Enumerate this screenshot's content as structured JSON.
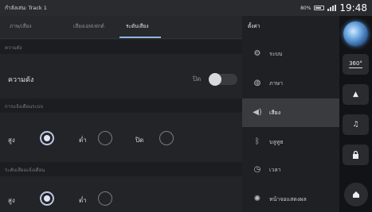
{
  "status_bar": {
    "title": "กำลังเล่น: Track 1",
    "battery_percent": "80%",
    "clock": "19:48"
  },
  "tabs": [
    {
      "label": "ภาพ/เสียง",
      "active": false
    },
    {
      "label": "เสียงเอฟเฟกต์",
      "active": false
    },
    {
      "label": "ระดับเสียง",
      "active": true
    }
  ],
  "sections": {
    "volume_header": "ความดัง",
    "volume_row_label": "ความดัง",
    "volume_toggle_label": "ปิด",
    "volume_toggle_state": "off",
    "alert_header": "การแจ้งเตือนระบบ",
    "alert_options": [
      {
        "label": "สูง",
        "checked": true
      },
      {
        "label": "ต่ำ",
        "checked": false
      },
      {
        "label": "ปิด",
        "checked": false
      }
    ],
    "reminder_header": "ระดับเสียงแจ้งเตือน",
    "reminder_options": [
      {
        "label": "สูง",
        "checked": true
      },
      {
        "label": "ต่ำ",
        "checked": false
      }
    ]
  },
  "menu": {
    "title": "ตั้งค่า",
    "items": [
      {
        "label": "ระบบ",
        "icon": "gear-icon",
        "active": false
      },
      {
        "label": "ภาษา",
        "icon": "globe-icon",
        "active": false
      },
      {
        "label": "เสียง",
        "icon": "speaker-icon",
        "active": true
      },
      {
        "label": "บลูทูธ",
        "icon": "bluetooth-icon",
        "active": false
      },
      {
        "label": "เวลา",
        "icon": "clock-icon",
        "active": false
      },
      {
        "label": "หน้าจอแสดงผล",
        "icon": "brightness-icon",
        "active": false
      }
    ]
  },
  "rail": {
    "camera_label": "360°",
    "accent": "#8fb2e0"
  }
}
